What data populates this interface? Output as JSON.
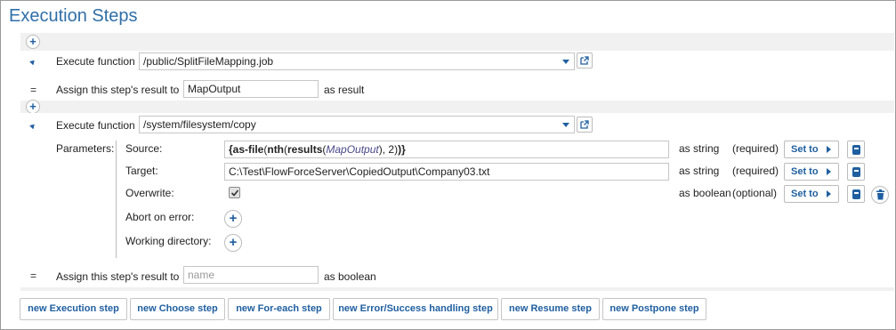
{
  "title": "Execution Steps",
  "steps": [
    {
      "execute_label": "Execute function",
      "function_path": "/public/SplitFileMapping.job",
      "assign_prefix": "Assign this step's result to",
      "assign_value": "MapOutput",
      "assign_placeholder": "",
      "assign_suffix": "as result"
    },
    {
      "execute_label": "Execute function",
      "function_path": "/system/filesystem/copy",
      "parameters_label": "Parameters:",
      "params": [
        {
          "name": "Source:",
          "type": "as string",
          "req": "(required)",
          "set_label": "Set to"
        },
        {
          "name": "Target:",
          "value": "C:\\Test\\FlowForceServer\\CopiedOutput\\Company03.txt",
          "type": "as string",
          "req": "(required)",
          "set_label": "Set to"
        },
        {
          "name": "Overwrite:",
          "checked": true,
          "type": "as boolean",
          "req": "(optional)",
          "set_label": "Set to"
        },
        {
          "name": "Abort on error:"
        },
        {
          "name": "Working directory:"
        }
      ],
      "source_expr": {
        "p1": "{",
        "f1": "as-file",
        "p2": "(",
        "f2": "nth",
        "p3": "(",
        "f3": "results",
        "p4": "(",
        "var": "MapOutput",
        "p5": "), 2)",
        "p6": ")}"
      },
      "assign_prefix": "Assign this step's result to",
      "assign_value": "",
      "assign_placeholder": "name",
      "assign_suffix": "as boolean"
    }
  ],
  "bottom_buttons": [
    "new Execution step",
    "new Choose step",
    "new For-each step",
    "new Error/Success handling step",
    "new Resume step",
    "new Postpone step"
  ],
  "colors": {
    "accent": "#1f5fa0",
    "title": "#2f6fa8",
    "band": "#f1f1f1"
  }
}
